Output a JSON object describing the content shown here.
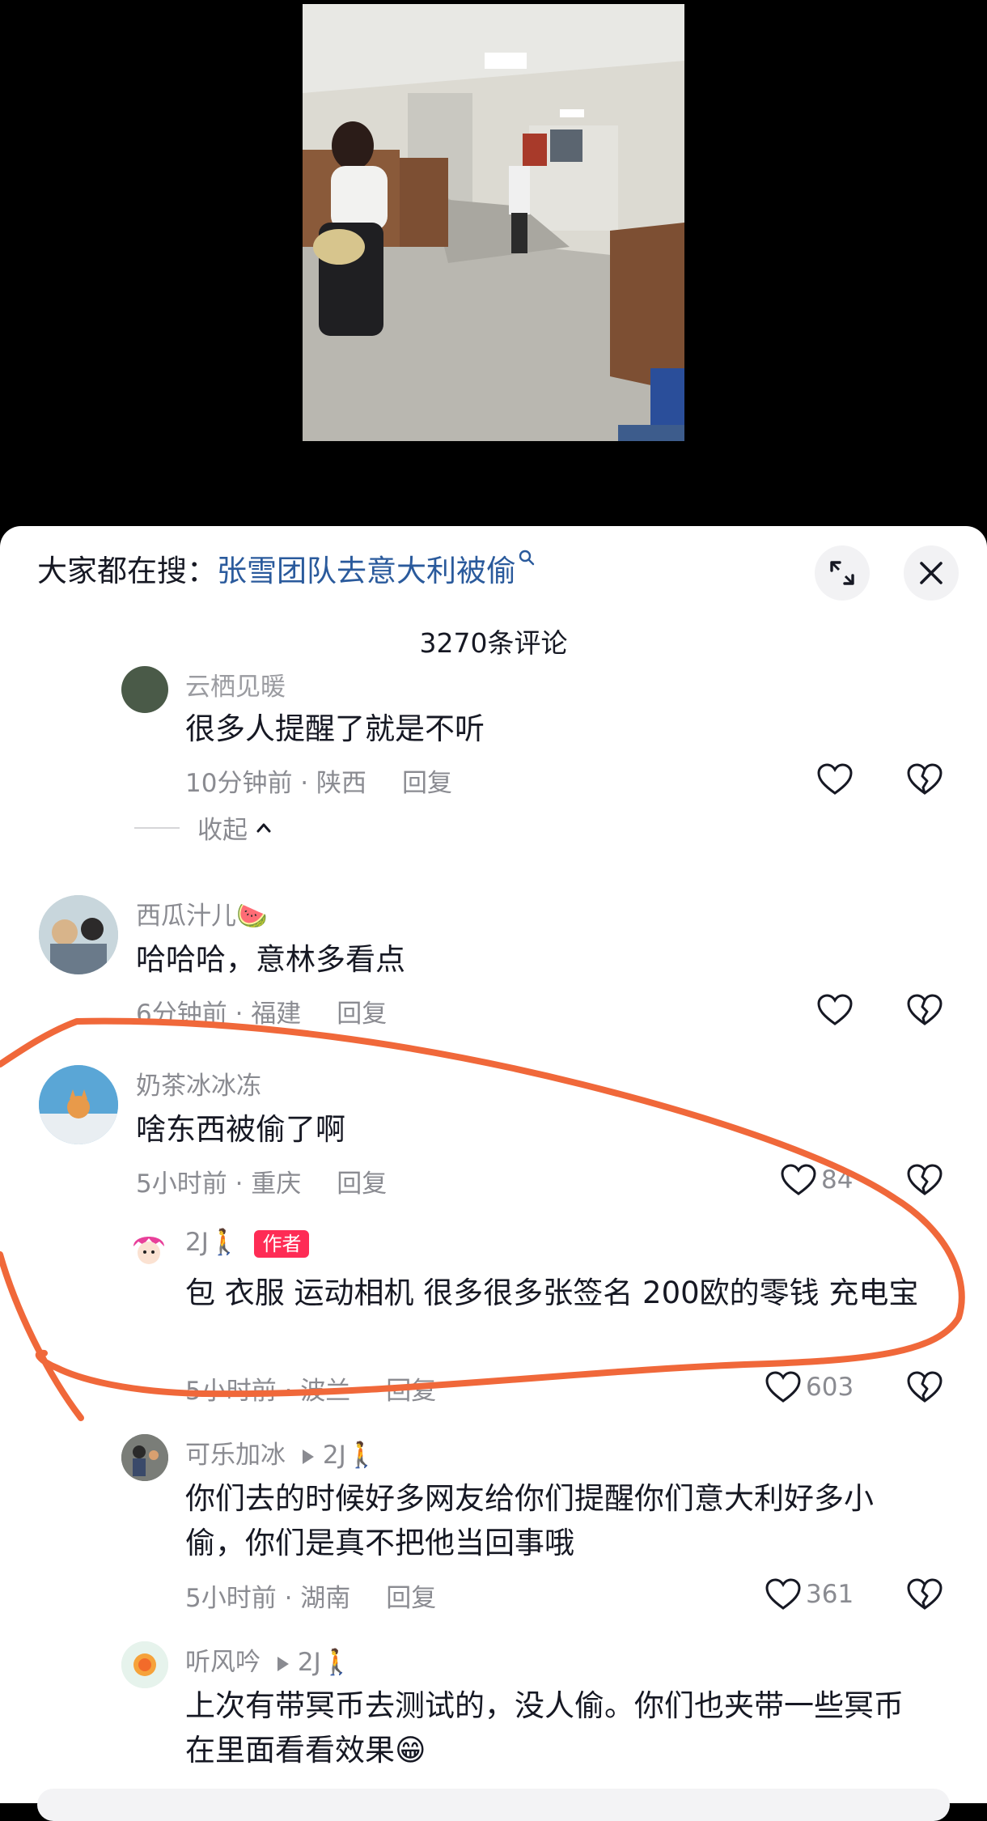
{
  "search": {
    "prefix": "大家都在搜：",
    "query": "张雪团队去意大利被偷"
  },
  "header": {
    "comment_count": "3270条评论"
  },
  "collapse_label": "收起",
  "comments": [
    {
      "username": "云栖见暖",
      "text": "很多人提醒了就是不听",
      "time": "10分钟前",
      "location": "陕西",
      "reply": "回复"
    },
    {
      "username": "西瓜汁儿🍉",
      "text": "哈哈哈，意林多看点",
      "time": "6分钟前",
      "location": "福建",
      "reply": "回复"
    },
    {
      "username": "奶茶冰冰冻",
      "text": "啥东西被偷了啊",
      "time": "5小时前",
      "location": "重庆",
      "reply": "回复",
      "likes": "84"
    },
    {
      "username": "2J🚶",
      "badge": "作者",
      "text": "包 衣服 运动相机 很多很多张签名 200欧的零钱 充电宝",
      "time": "5小时前",
      "location": "波兰",
      "reply": "回复",
      "likes": "603"
    },
    {
      "username": "可乐加冰",
      "reply_to": "2J🚶",
      "text": "你们去的时候好多网友给你们提醒你们意大利好多小偷，你们是真不把他当回事哦",
      "time": "5小时前",
      "location": "湖南",
      "reply": "回复",
      "likes": "361"
    },
    {
      "username": "听风吟",
      "reply_to": "2J🚶",
      "text": "上次有带冥币去测试的，没人偷。你们也夹带一些冥币在里面看看效果😁"
    }
  ],
  "colors": {
    "accent_red": "#fe2c55",
    "link_blue": "#2a5a9c",
    "annotation_orange": "#f0683a"
  }
}
